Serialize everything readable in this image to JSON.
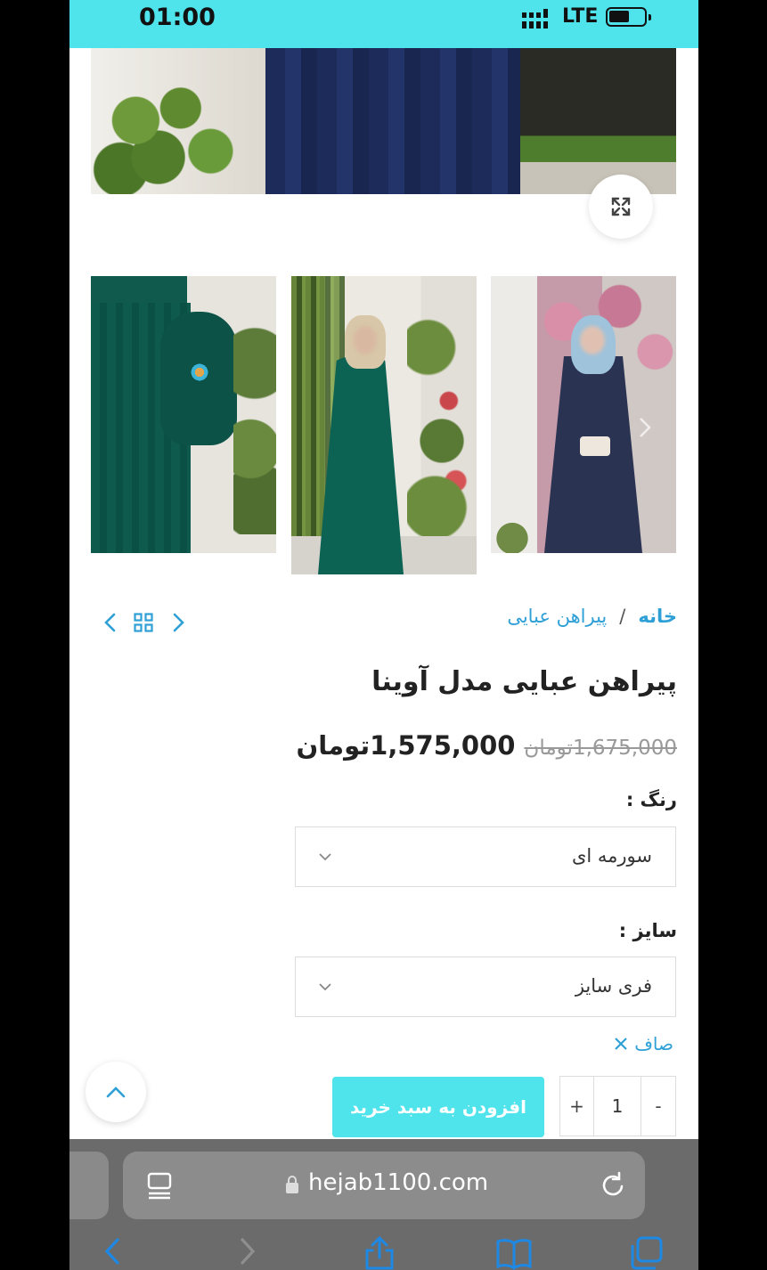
{
  "status_bar": {
    "time": "01:00",
    "network": "LTE"
  },
  "breadcrumb": {
    "home": "خانه",
    "separator": "/",
    "category": "پیراهن عبایی"
  },
  "product": {
    "title": "پیراهن عبایی مدل آوینا",
    "old_price": "1,675,000تومان",
    "new_price": "1,575,000تومان"
  },
  "options": {
    "color_label": "رنگ :",
    "color_value": "سورمه ای",
    "size_label": "سایز :",
    "size_value": "فری سایز",
    "clear_label": "صاف"
  },
  "cart": {
    "quantity": "1",
    "plus": "+",
    "minus": "-",
    "add_label": "افزودن به سبد خرید"
  },
  "browser": {
    "url": "hejab1100.com"
  },
  "colors": {
    "accent": "#4fe3ec",
    "link": "#2fa0d6"
  }
}
